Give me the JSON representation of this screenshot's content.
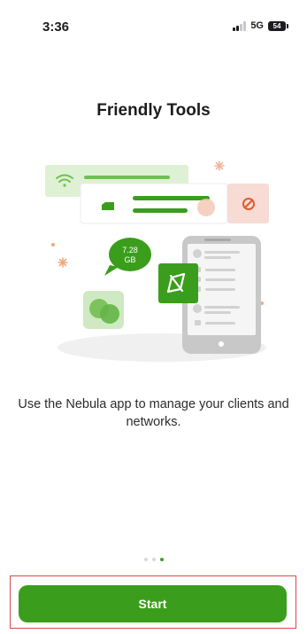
{
  "status_bar": {
    "time": "3:36",
    "network": "5G",
    "battery": "54"
  },
  "onboarding": {
    "title": "Friendly Tools",
    "description": "Use the Nebula app to manage your clients and networks.",
    "data_badge": [
      "7.28",
      "GB"
    ],
    "page_indicator": {
      "pages": 3,
      "active": 3
    }
  },
  "actions": {
    "start_label": "Start"
  },
  "colors": {
    "accent": "#3a9e1c",
    "highlight_border": "#d94a4a"
  }
}
